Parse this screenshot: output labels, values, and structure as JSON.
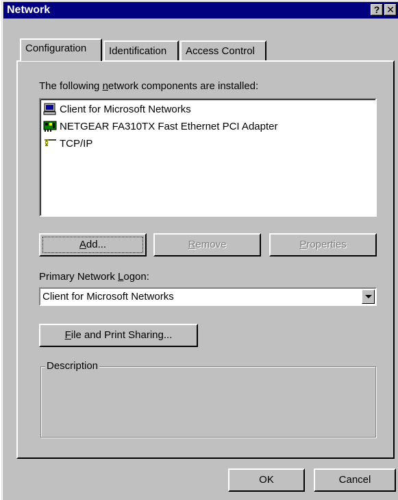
{
  "window": {
    "title": "Network",
    "help_glyph": "?",
    "close_glyph": "✕"
  },
  "tabs": [
    {
      "label": "Configuration",
      "active": true
    },
    {
      "label": "Identification",
      "active": false
    },
    {
      "label": "Access Control",
      "active": false
    }
  ],
  "components": {
    "label_pre": "The following ",
    "label_accel": "n",
    "label_post": "etwork components are installed:",
    "items": [
      {
        "label": "Client for Microsoft Networks",
        "icon": "client-icon"
      },
      {
        "label": "NETGEAR FA310TX Fast Ethernet PCI Adapter",
        "icon": "network-adapter-icon"
      },
      {
        "label": "TCP/IP",
        "icon": "protocol-icon"
      }
    ]
  },
  "buttons": {
    "add_accel": "A",
    "add_rest": "dd...",
    "remove_accel": "R",
    "remove_rest": "emove",
    "properties_accel": "P",
    "properties_rest": "roperties",
    "file_sharing_accel": "F",
    "file_sharing_rest": "ile and Print Sharing...",
    "ok": "OK",
    "cancel": "Cancel"
  },
  "primary_logon": {
    "label_pre": "Primary Network ",
    "label_accel": "L",
    "label_post": "ogon:",
    "value": "Client for Microsoft Networks"
  },
  "description": {
    "group_label": "Description",
    "text": ""
  },
  "colors": {
    "titlebar": "#000080",
    "face": "#c0c0c0"
  }
}
